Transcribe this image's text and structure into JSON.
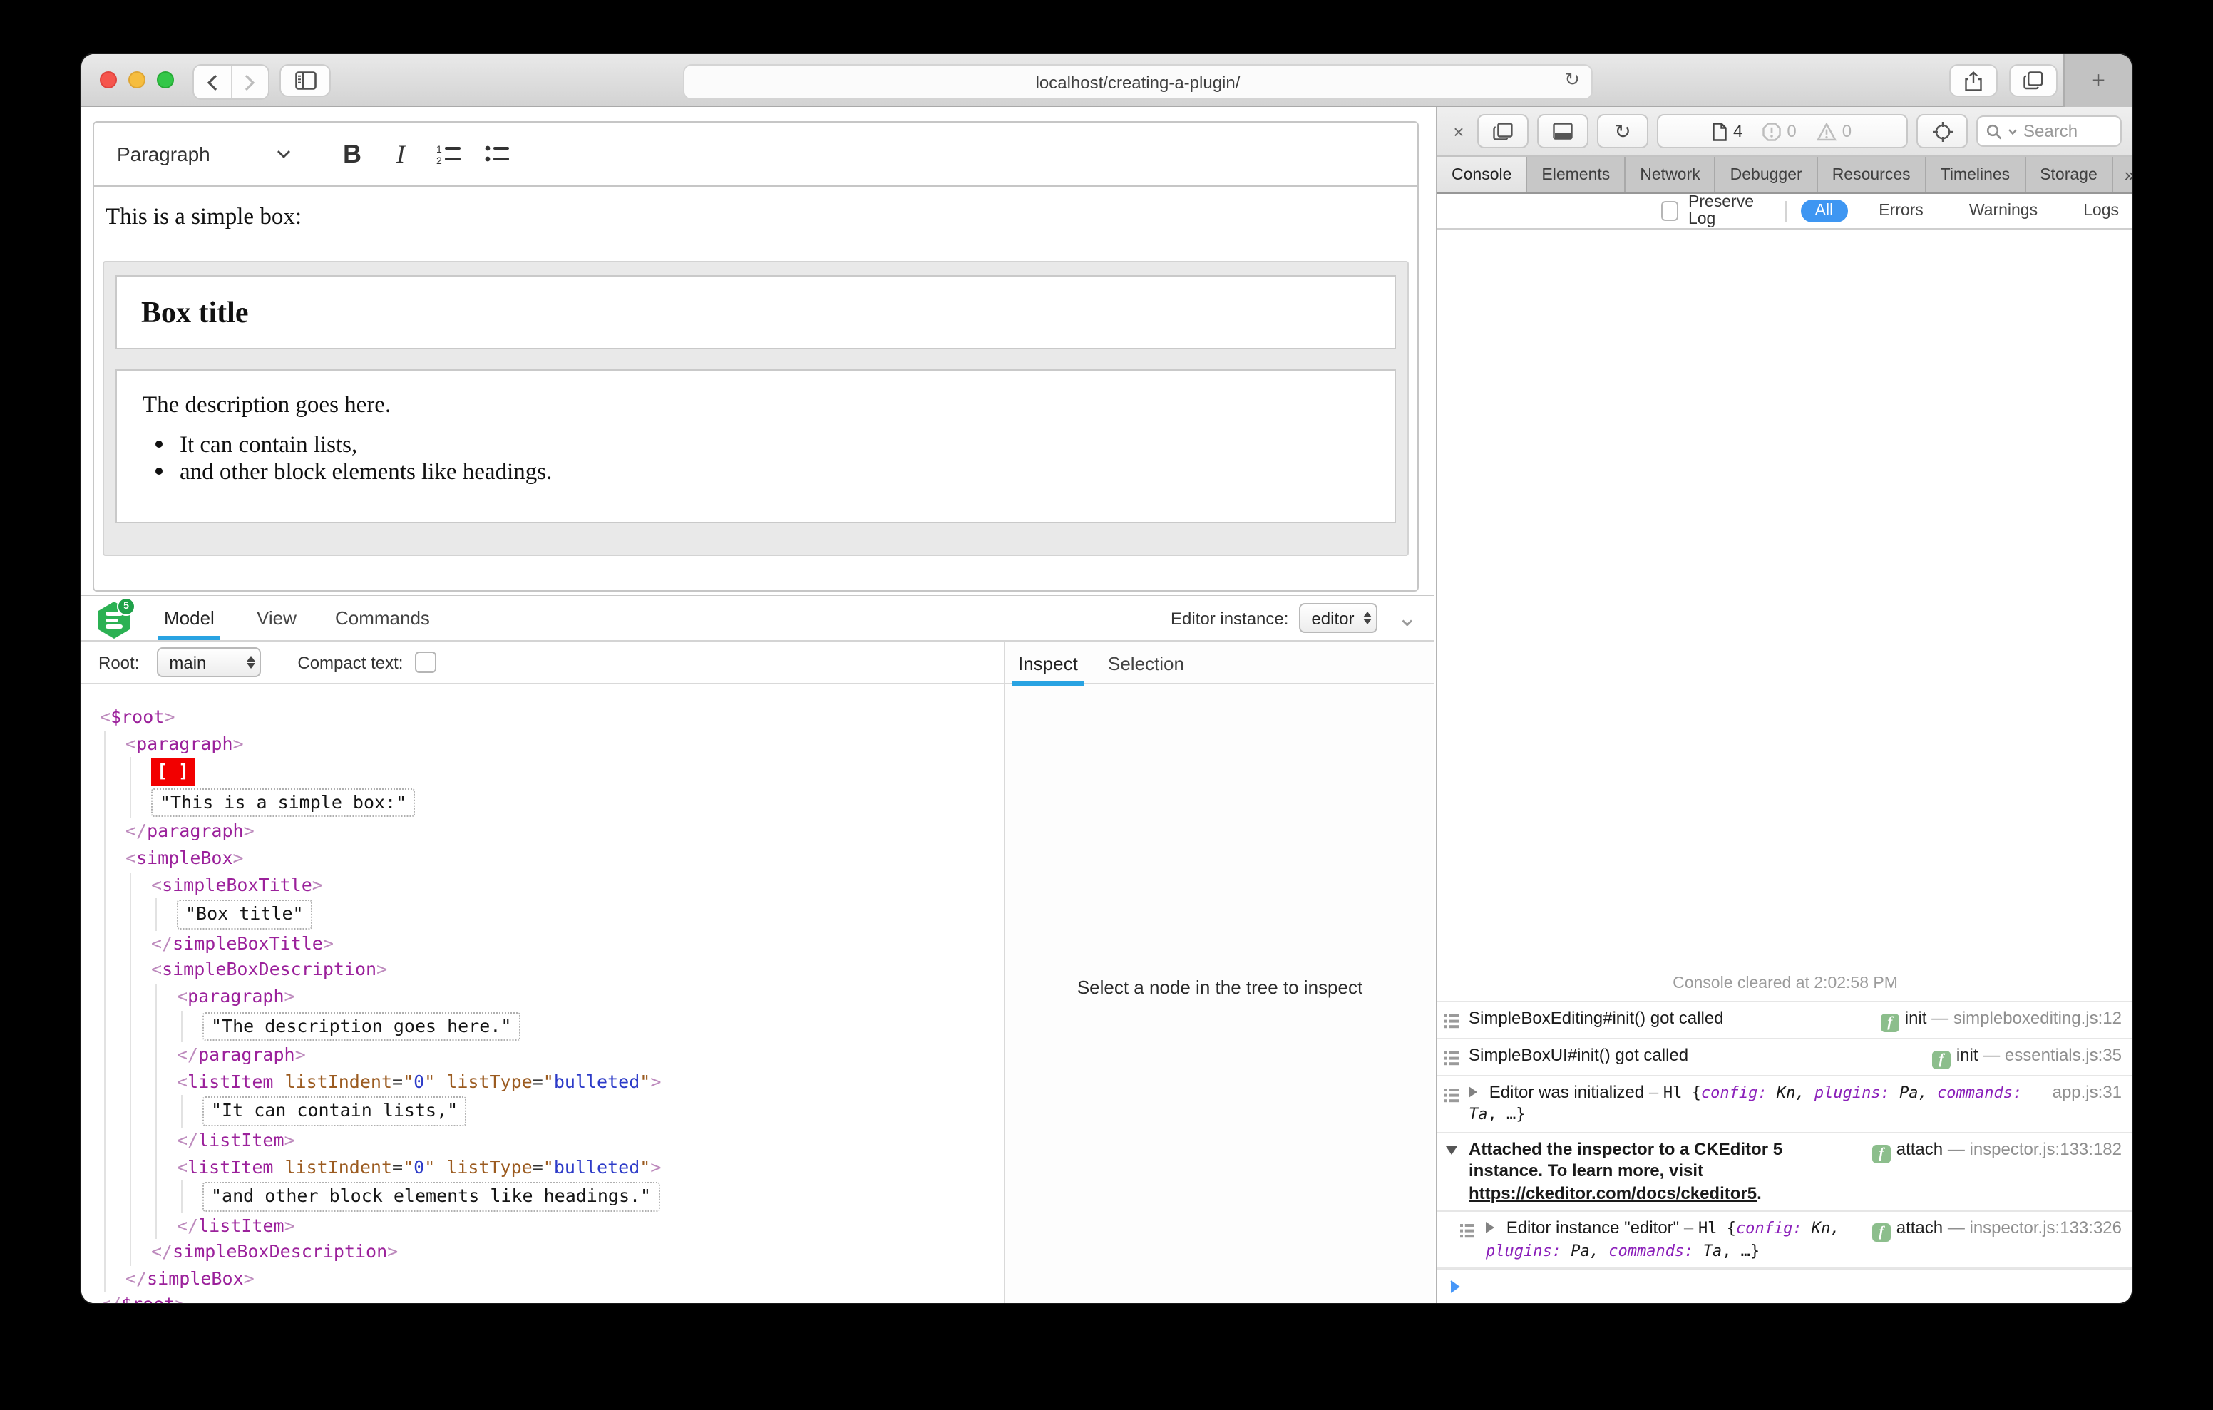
{
  "glyphs": {
    "close": "×",
    "reload": "↻",
    "plus": "+",
    "more": "»",
    "add": "+",
    "gear": "⚙",
    "chevron_down": "⌄",
    "bold": "B",
    "italic": "I",
    "n1": "1",
    "n2": "2"
  },
  "browser": {
    "url": "localhost/creating-a-plugin/"
  },
  "editor": {
    "toolbar": {
      "style_label": "Paragraph"
    },
    "content": {
      "intro": "This is a simple box:",
      "box_title": "Box title",
      "box_description": "The description goes here.",
      "bullets": {
        "b1": "It can contain lists,",
        "b2": "and other block elements like headings."
      }
    }
  },
  "ck": {
    "tabs": {
      "model": "Model",
      "view": "View",
      "commands": "Commands"
    },
    "logo_badge": "5",
    "instance_label": "Editor instance:",
    "instance_value": "editor",
    "root_label": "Root:",
    "root_value": "main",
    "compact_label": "Compact text:",
    "subtabs": {
      "inspect": "Inspect",
      "selection": "Selection"
    },
    "placeholder": "Select a node in the tree to inspect",
    "syntax": {
      "lt": "<",
      "ltc": "</",
      "gt": ">",
      "eq": "=",
      "q": "\""
    },
    "tree": {
      "sel": "[ ]",
      "names": {
        "root": "$root",
        "paragraph": "paragraph",
        "simpleBox": "simpleBox",
        "simpleBoxTitle": "simpleBoxTitle",
        "simpleBoxDescription": "simpleBoxDescription",
        "listItem": "listItem"
      },
      "attrs": {
        "a1": "listIndent",
        "v1": "0",
        "a2": "listType",
        "v2": "bulleted"
      },
      "texts": {
        "intro": "\"This is a simple box:\"",
        "title": "\"Box title\"",
        "desc": "\"The description goes here.\"",
        "li1": "\"It can contain lists,\"",
        "li2": "\"and other block elements like headings.\""
      }
    }
  },
  "wi": {
    "badges": {
      "pages": "4",
      "errors": "0",
      "warnings": "0"
    },
    "search_placeholder": "Search",
    "tabs": {
      "t1": "Console",
      "t2": "Elements",
      "t3": "Network",
      "t4": "Debugger",
      "t5": "Resources",
      "t6": "Timelines",
      "t7": "Storage"
    },
    "filter": {
      "preserve": "Preserve Log",
      "all": "All",
      "errors": "Errors",
      "warnings": "Warnings",
      "logs": "Logs"
    },
    "console": {
      "cleared": "Console cleared at 2:02:58 PM",
      "m1": {
        "text": "SimpleBoxEditing#init() got called",
        "fn": "init",
        "dash": "—",
        "loc": "simpleboxediting.js:12"
      },
      "m2": {
        "text": "SimpleBoxUI#init() got called",
        "fn": "init",
        "dash": "—",
        "loc": "essentials.js:35"
      },
      "m3": {
        "pre": "Editor was initialized",
        "dash": "–",
        "cls": "Hl",
        "b1": "{",
        "k1": "config:",
        "v1": "Kn,",
        "k2": "plugins:",
        "v2": "Pa,",
        "k3": "commands:",
        "v3": "Ta",
        "tail": ", …}",
        "loc": "app.js:31"
      },
      "m4": {
        "text": "Attached the inspector to a CKEditor 5 instance. To learn more, visit ",
        "link": "https://ckeditor.com/docs/ckeditor5",
        "suffix": ".",
        "fn": "attach",
        "dash": "—",
        "loc": "inspector.js:133:182"
      },
      "m5": {
        "pre": "Editor instance \"editor\"",
        "dash": "–",
        "cls": "Hl",
        "b1": "{",
        "k1": "config:",
        "v1": "Kn,",
        "k2": "plugins:",
        "v2": "Pa,",
        "k3": "commands:",
        "v3": "Ta",
        "tail": ", …}",
        "fn": "attach",
        "dash2": "—",
        "loc": "inspector.js:133:326"
      }
    }
  }
}
